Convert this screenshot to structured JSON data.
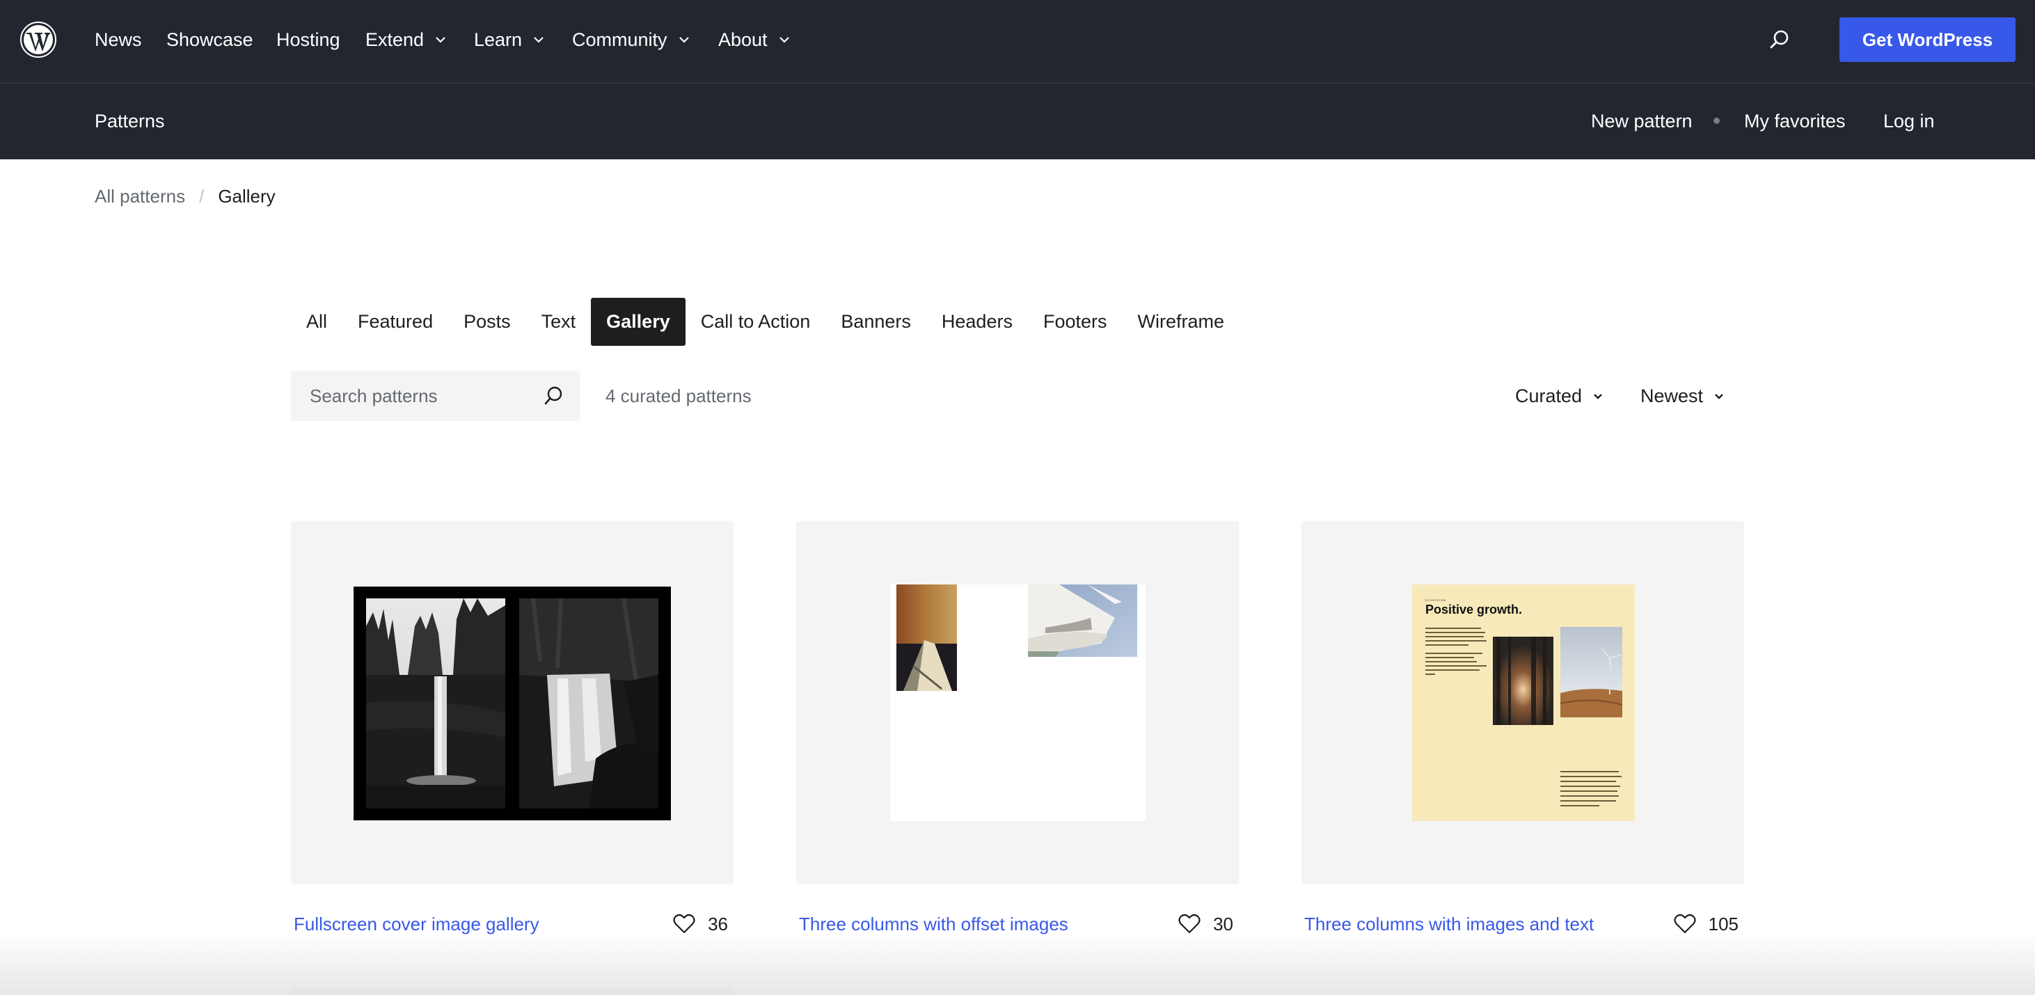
{
  "header": {
    "logo": "wordpress-logo",
    "nav": [
      {
        "label": "News",
        "has_dropdown": false
      },
      {
        "label": "Showcase",
        "has_dropdown": false
      },
      {
        "label": "Hosting",
        "has_dropdown": false
      },
      {
        "label": "Extend",
        "has_dropdown": true
      },
      {
        "label": "Learn",
        "has_dropdown": true
      },
      {
        "label": "Community",
        "has_dropdown": true
      },
      {
        "label": "About",
        "has_dropdown": true
      }
    ],
    "search_icon": "search-icon",
    "cta_label": "Get WordPress",
    "cta_color": "#3858e9"
  },
  "subheader": {
    "title": "Patterns",
    "links": [
      "New pattern",
      "My favorites",
      "Log in"
    ]
  },
  "breadcrumb": {
    "parent": "All patterns",
    "separator": "/",
    "current": "Gallery"
  },
  "tabs": {
    "items": [
      "All",
      "Featured",
      "Posts",
      "Text",
      "Gallery",
      "Call to Action",
      "Banners",
      "Headers",
      "Footers",
      "Wireframe"
    ],
    "active": "Gallery"
  },
  "filters": {
    "search_placeholder": "Search patterns",
    "search_value": "",
    "result_count": "4 curated patterns",
    "curation": "Curated",
    "sort": "Newest"
  },
  "patterns": [
    {
      "title": "Fullscreen cover image gallery",
      "likes": "36"
    },
    {
      "title": "Three columns with offset images",
      "likes": "30"
    },
    {
      "title": "Three columns with images and text",
      "likes": "105"
    }
  ],
  "preview_text": {
    "p3_kicker": "ECOSYSTEM",
    "p3_heading": "Positive growth."
  },
  "colors": {
    "header_bg": "#22272f",
    "link": "#3858e9",
    "active_tab": "#1e1e1e"
  }
}
